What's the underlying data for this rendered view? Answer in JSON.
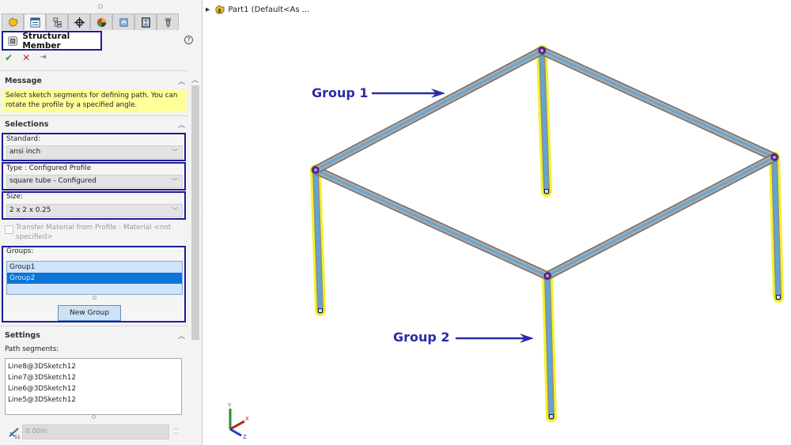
{
  "property_manager": {
    "tabs": [
      {
        "icon": "feature-manager-icon",
        "active": false
      },
      {
        "icon": "property-manager-icon",
        "active": true
      },
      {
        "icon": "configuration-manager-icon",
        "active": false
      },
      {
        "icon": "dimxpert-manager-icon",
        "active": false
      },
      {
        "icon": "display-manager-icon",
        "active": false
      },
      {
        "icon": "cam-feature-manager-icon",
        "active": false
      },
      {
        "icon": "cam-operation-tree-icon",
        "active": false
      },
      {
        "icon": "cam-tool-tree-icon",
        "active": false
      }
    ],
    "title": "Structural Member",
    "help": "?",
    "actions": {
      "ok": "✔",
      "cancel": "✕",
      "pin": "⇥"
    },
    "message_section": {
      "title": "Message",
      "text": "Select sketch segments for defining path. You can rotate the profile by a specified angle."
    },
    "selections_section": {
      "title": "Selections",
      "standard_label": "Standard:",
      "standard_value": "ansi inch",
      "type_label": "Type : Configured Profile",
      "type_value": "square tube - Configured",
      "size_label": "Size:",
      "size_value": "2 x 2 x 0.25",
      "transfer_material_label": "Transfer Material from Profile : Material <not specified>",
      "transfer_material_checked": false,
      "groups_label": "Groups:",
      "groups": [
        {
          "name": "Group1",
          "selected": false
        },
        {
          "name": "Group2",
          "selected": true
        }
      ],
      "new_group_button": "New Group"
    },
    "settings_section": {
      "title": "Settings",
      "path_segments_label": "Path segments:",
      "path_segments": [
        "Line8@3DSketch12",
        "Line7@3DSketch12",
        "Line6@3DSketch12",
        "Line5@3DSketch12"
      ],
      "rotation_angle": "0.00in"
    }
  },
  "viewport": {
    "tree_item": "Part1  (Default<As ...",
    "annotations": [
      {
        "label": "Group 1"
      },
      {
        "label": "Group 2"
      }
    ],
    "triad": {
      "x": "X",
      "y": "Y",
      "z": "Z"
    },
    "colors": {
      "annotation": "#2b2ba8",
      "member_steel": "#8f8f8f",
      "member_highlight": "#5aa7dc",
      "selection_yellow": "#f2f22a",
      "joint_purple": "#7b2a9a",
      "outline_blue": "#1d1d9a"
    }
  }
}
